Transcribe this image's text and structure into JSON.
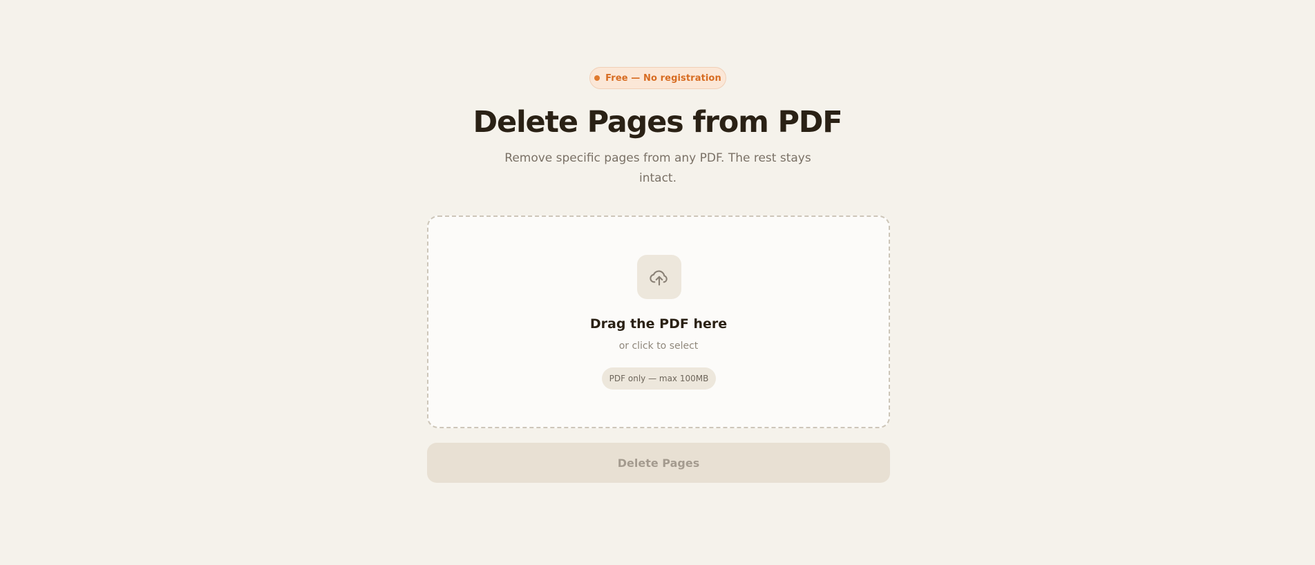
{
  "badge": {
    "text": "Free — No registration",
    "dot_color": "#e07a2e"
  },
  "hero": {
    "title": "Delete Pages from PDF",
    "subtitle": "Remove specific pages from any PDF. The rest stays intact."
  },
  "dropzone": {
    "icon": "cloud-upload-icon",
    "title": "Drag the PDF here",
    "subtitle": "or click to select",
    "hint": "PDF only — max 100MB"
  },
  "action": {
    "label": "Delete Pages",
    "disabled": true
  },
  "colors": {
    "background": "#f5f2eb",
    "accent": "#d76c22",
    "heading": "#2a2115"
  }
}
